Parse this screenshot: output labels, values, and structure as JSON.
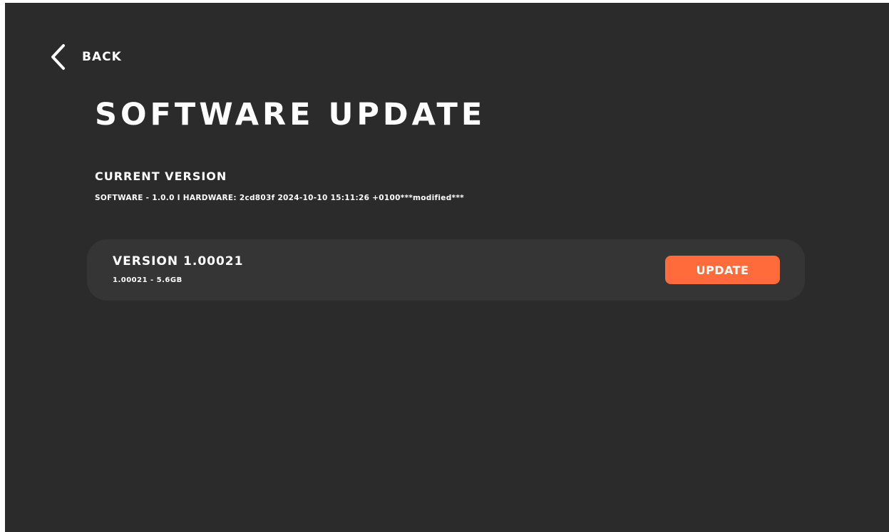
{
  "header": {
    "back_label": "BACK",
    "back_icon": "chevron-left-icon"
  },
  "page": {
    "title": "SOFTWARE UPDATE"
  },
  "current_version": {
    "heading": "CURRENT VERSION",
    "info": "SOFTWARE - 1.0.0 I HARDWARE: 2cd803f 2024-10-10 15:11:26 +0100***modified***"
  },
  "available_update": {
    "title": "VERSION 1.00021",
    "meta": "1.00021 - 5.6GB",
    "button_label": "UPDATE"
  },
  "colors": {
    "background": "#2b2b2b",
    "card": "#353535",
    "accent": "#ff6b3b",
    "text": "#ffffff"
  }
}
